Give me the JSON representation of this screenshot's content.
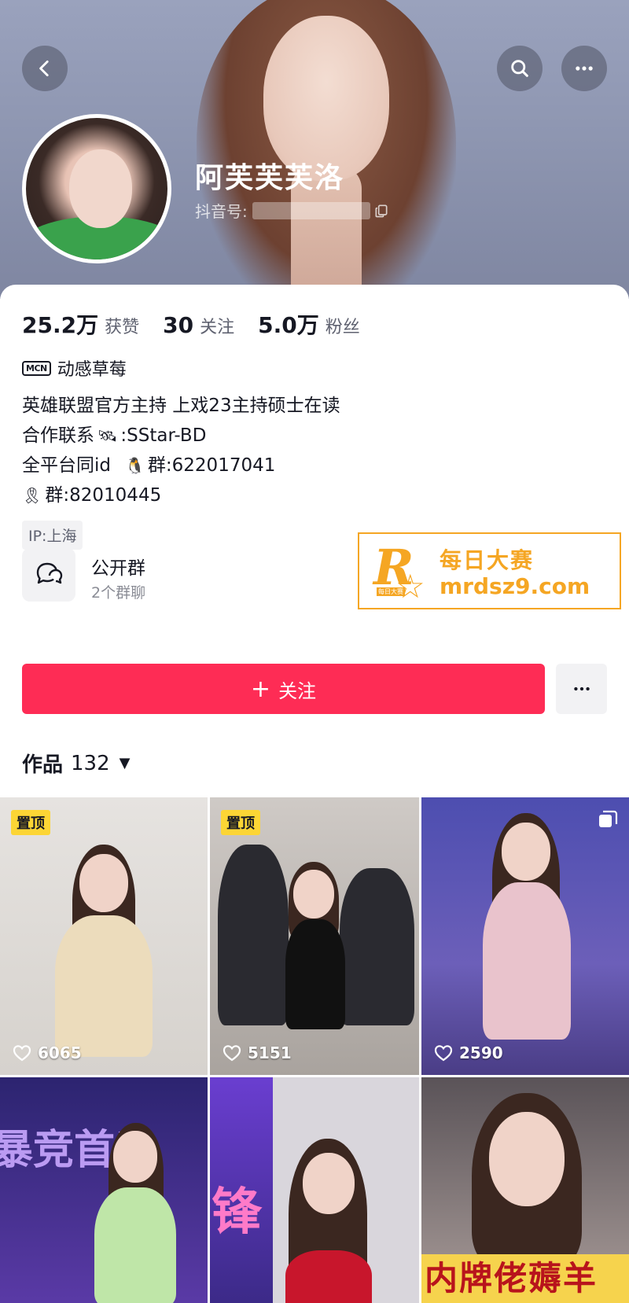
{
  "profile": {
    "name": "阿芙芙芙洛",
    "douyin_id_label": "抖音号:"
  },
  "stats": [
    {
      "value": "25.2万",
      "label": "获赞"
    },
    {
      "value": "30",
      "label": "关注"
    },
    {
      "value": "5.0万",
      "label": "粉丝"
    }
  ],
  "mcn": {
    "badge": "MCN",
    "name": "动感草莓"
  },
  "bio": {
    "line1": "英雄联盟官方主持 上戏23主持硕士在读",
    "line2_prefix": "合作联系",
    "line2_suffix": ":SStar-BD",
    "line3_prefix": "全平台同id",
    "line3_suffix": "群:622017041",
    "line4_suffix": "群:82010445"
  },
  "ip": {
    "label": "IP:上海"
  },
  "group": {
    "title": "公开群",
    "subtitle": "2个群聊"
  },
  "promo": {
    "cn": "每日大赛",
    "url": "mrdsz9.com",
    "logo_letter": "R",
    "logo_small": "每日大赛"
  },
  "actions": {
    "follow": "关注",
    "follow_plus": "+"
  },
  "works": {
    "label": "作品",
    "count": "132"
  },
  "videos": [
    {
      "pinned": "置顶",
      "likes": "6065",
      "multi": false
    },
    {
      "pinned": "置顶",
      "likes": "5151",
      "multi": false
    },
    {
      "pinned": "",
      "likes": "2590",
      "multi": true
    },
    {
      "pinned": "",
      "likes": "",
      "multi": false
    },
    {
      "pinned": "",
      "likes": "",
      "multi": false
    },
    {
      "pinned": "",
      "likes": "",
      "multi": false
    }
  ],
  "tile_texts": {
    "t6_sign": "内牌佬薅羊",
    "t5_banner": "锋",
    "t4_banner": "暴竞首秀"
  },
  "colors": {
    "accent": "#fe2c55",
    "pin": "#fcd535",
    "promo": "#f5a623"
  },
  "icons": [
    "back-icon",
    "search-icon",
    "more-icon",
    "copy-icon",
    "chat-group-icon",
    "heart-icon",
    "multi-image-icon",
    "caret-down-icon"
  ]
}
